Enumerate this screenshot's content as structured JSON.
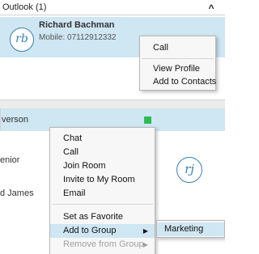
{
  "top_panel": {
    "group_header": "Outlook (1)",
    "group_toggle_icon": "chevron-up-icon",
    "group_toggle_glyph": "^",
    "contact": {
      "initials": "rb",
      "name": "Richard Bachman",
      "subtitle": "Mobile: 07112912332"
    },
    "context_menu": {
      "items": [
        "Call",
        "View Profile",
        "Add to Contacts"
      ]
    }
  },
  "bottom_panel": {
    "selected_row_name": "verson",
    "status_color": "#2dbc54",
    "row2_text": "enior",
    "row3_text": "d James",
    "avatar_initials": "rj",
    "context_menu": {
      "items": [
        "Chat",
        "Call",
        "Join Room",
        "Invite to My Room",
        "Email",
        "Set as Favorite",
        "Add to Group",
        "Remove from Group"
      ],
      "highlighted": "Add to Group",
      "disabled": "Remove from Group",
      "submenu_arrow": "▶"
    },
    "submenu": {
      "items": [
        "Marketing"
      ]
    }
  },
  "colors": {
    "selection": "#cfe6f3",
    "accent": "#3a7fb3",
    "status_green": "#2dbc54"
  }
}
